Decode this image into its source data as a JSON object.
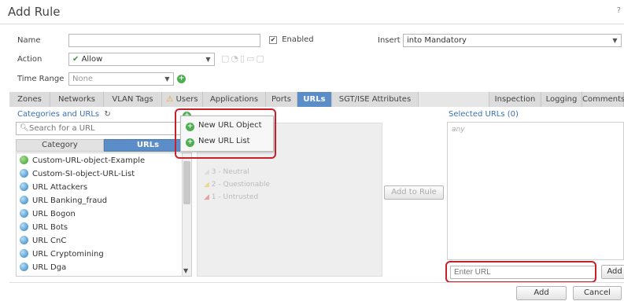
{
  "dialog": {
    "title": "Add Rule",
    "help": "?"
  },
  "form": {
    "name_label": "Name",
    "name_value": "",
    "enabled_label": "Enabled",
    "enabled_checked": true,
    "insert_label": "Insert",
    "insert_value": "into Mandatory",
    "action_label": "Action",
    "action_value": "Allow",
    "time_range_label": "Time Range",
    "time_range_value": "None"
  },
  "tabs": [
    "Zones",
    "Networks",
    "VLAN Tags",
    "Users",
    "Applications",
    "Ports",
    "URLs",
    "SGT/ISE Attributes",
    "Inspection",
    "Logging",
    "Comments"
  ],
  "active_tab": "URLs",
  "left_panel": {
    "header": "Categories and URLs",
    "search_placeholder": "Search for a URL",
    "subtabs": [
      "Category",
      "URLs"
    ],
    "items": [
      {
        "label": "Custom-URL-object-Example",
        "icon": "globe-icon"
      },
      {
        "label": "Custom-SI-object-URL-List",
        "icon": "url-object-icon"
      },
      {
        "label": "URL Attackers",
        "icon": "url-object-icon"
      },
      {
        "label": "URL Banking_fraud",
        "icon": "url-object-icon"
      },
      {
        "label": "URL Bogon",
        "icon": "url-object-icon"
      },
      {
        "label": "URL Bots",
        "icon": "url-object-icon"
      },
      {
        "label": "URL CnC",
        "icon": "url-object-icon"
      },
      {
        "label": "URL Cryptomining",
        "icon": "url-object-icon"
      },
      {
        "label": "URL Dga",
        "icon": "url-object-icon"
      }
    ]
  },
  "popup": {
    "items": [
      "New URL Object",
      "New URL List"
    ]
  },
  "reputation": {
    "items": [
      "3 - Neutral",
      "2 - Questionable",
      "1 - Untrusted"
    ]
  },
  "add_to_rule_label": "Add to Rule",
  "right_panel": {
    "header": "Selected URLs (0)",
    "any_text": "any",
    "enter_url_placeholder": "Enter URL",
    "add_label": "Add"
  },
  "footer": {
    "add_label": "Add",
    "cancel_label": "Cancel"
  },
  "colors": {
    "accent": "#3b6fb5",
    "active_tab": "#5b8ec8",
    "highlight": "#c8202a"
  }
}
